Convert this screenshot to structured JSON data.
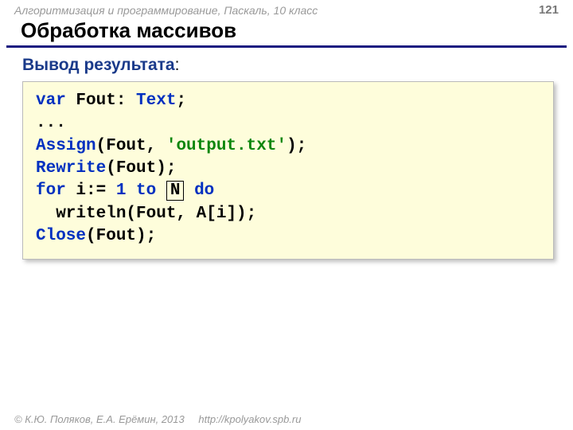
{
  "header": {
    "course": "Алгоритмизация и программирование, Паскаль, 10 класс",
    "page": "121"
  },
  "title": "Обработка массивов",
  "subtitle": "Вывод результата",
  "code": {
    "l1_a": "var",
    "l1_b": " Fout: ",
    "l1_c": "Text",
    "l1_d": ";",
    "l2": "...",
    "l3_a": "Assign",
    "l3_b": "(Fout, ",
    "l3_c": "'output.txt'",
    "l3_d": ");",
    "l4_a": "Rewrite",
    "l4_b": "(Fout);",
    "l5_a": "for",
    "l5_b": " i:= ",
    "l5_c": "1",
    "l5_d": " to ",
    "l5_box": "N",
    "l5_e": " do",
    "l6": "  writeln(Fout, A[i]);",
    "l7_a": "Close",
    "l7_b": "(Fout);"
  },
  "footer": {
    "copyright": "© К.Ю. Поляков, Е.А. Ерёмин, 2013",
    "url": "http://kpolyakov.spb.ru"
  }
}
